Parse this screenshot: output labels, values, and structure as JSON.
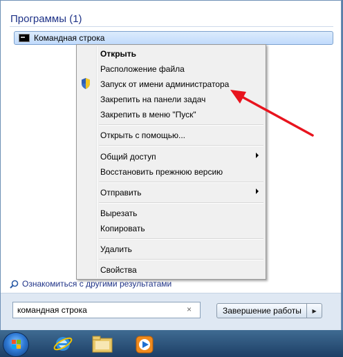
{
  "start_menu": {
    "programs_header": "Программы (1)",
    "program_item": "Командная строка",
    "more_results": "Ознакомиться с другими результатами",
    "search_value": "командная строка",
    "search_clear": "×",
    "shutdown_label": "Завершение работы",
    "shutdown_arrow": "▶"
  },
  "context_menu": {
    "items": [
      {
        "label": "Открыть",
        "bold": true
      },
      {
        "label": "Расположение файла"
      },
      {
        "label": "Запуск от имени администратора",
        "icon": "uac-shield-icon"
      },
      {
        "label": "Закрепить на панели задач"
      },
      {
        "label": "Закрепить в меню \"Пуск\""
      },
      {
        "label": "Открыть с помощью..."
      },
      {
        "label": "Общий доступ",
        "submenu": true
      },
      {
        "label": "Восстановить прежнюю версию"
      },
      {
        "label": "Отправить",
        "submenu": true
      },
      {
        "label": "Вырезать"
      },
      {
        "label": "Копировать"
      },
      {
        "label": "Удалить"
      },
      {
        "label": "Свойства"
      }
    ]
  },
  "taskbar": {
    "icons": [
      "start-orb-icon",
      "internet-explorer-icon",
      "explorer-folder-icon",
      "media-player-icon"
    ]
  },
  "colors": {
    "annotation_arrow": "#e8141e",
    "header_text": "#1e3287",
    "selection": "#c1dbfc"
  }
}
